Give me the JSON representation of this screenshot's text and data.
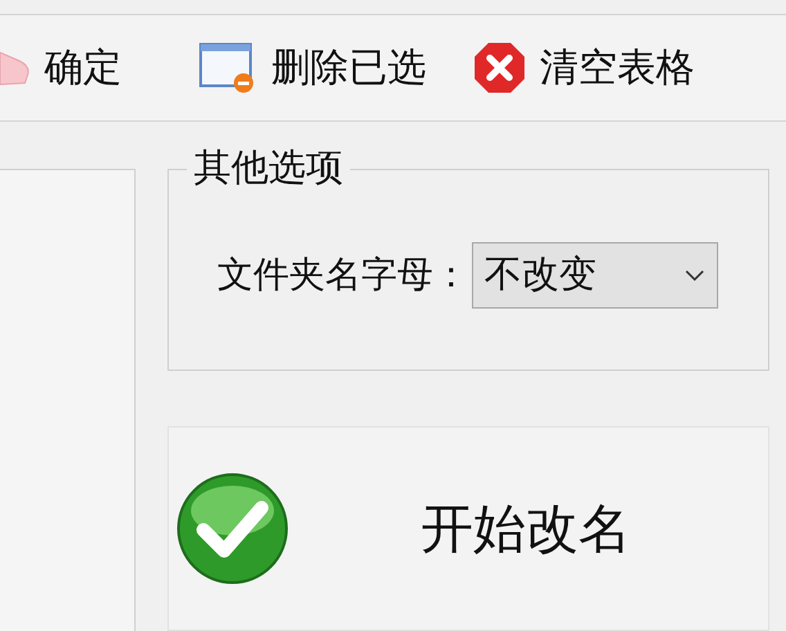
{
  "toolbar": [
    {
      "kind": "hand",
      "label": "确定"
    },
    {
      "kind": "remove-window",
      "label": "删除已选"
    },
    {
      "kind": "clear",
      "label": "清空表格"
    }
  ],
  "other_options": {
    "title": "其他选项",
    "label": "文件夹名字母：",
    "dropdown": {
      "value": "不改变"
    }
  },
  "start_button": {
    "label": "开始改名"
  }
}
